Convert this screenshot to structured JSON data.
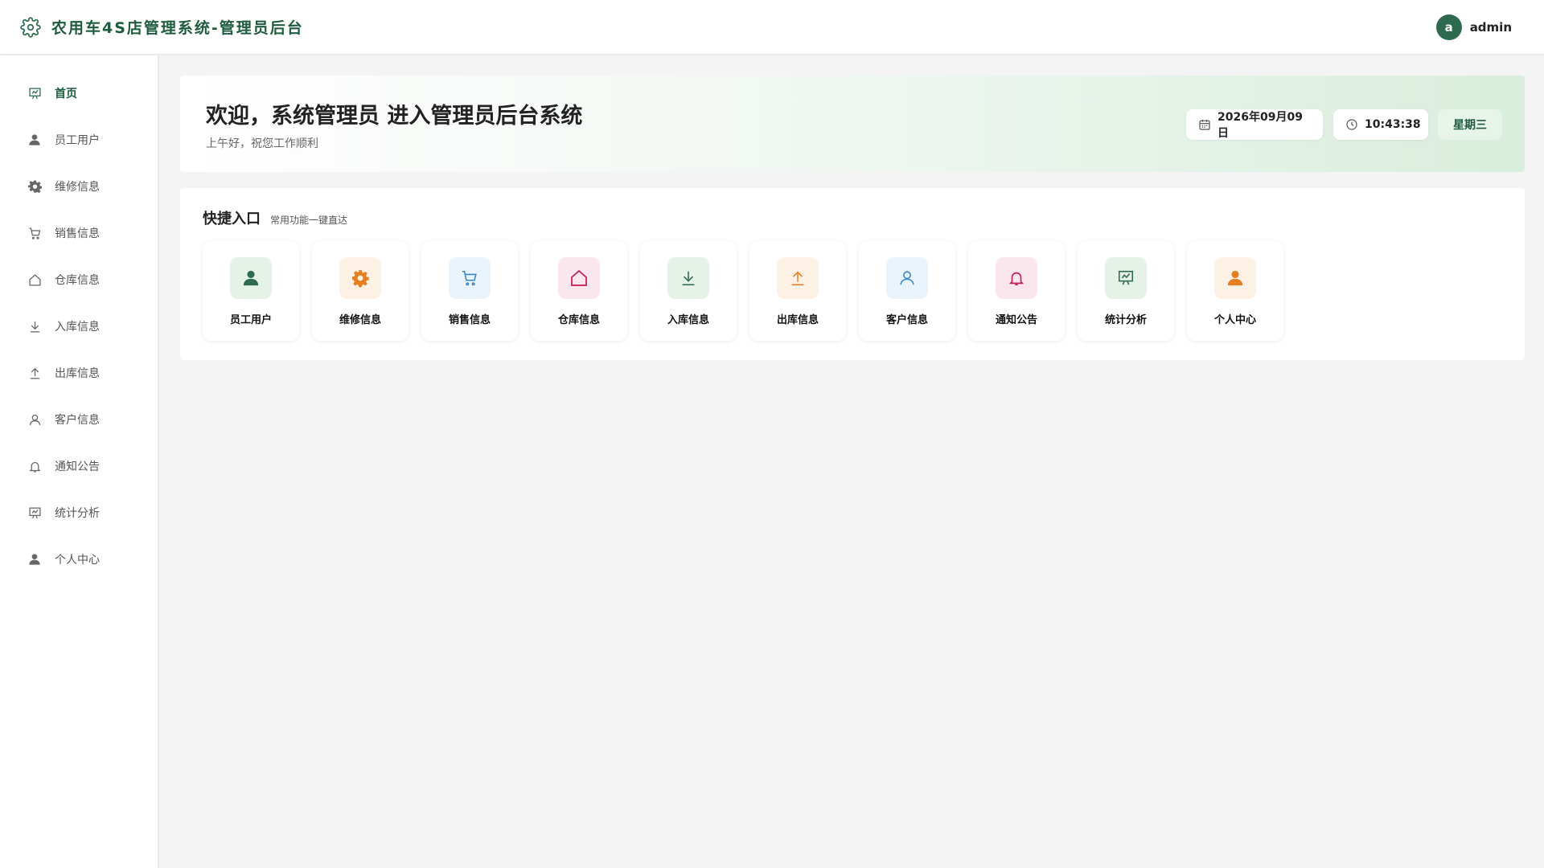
{
  "header": {
    "title": "农用车4S店管理系统-管理员后台",
    "avatar_letter": "a",
    "username": "admin"
  },
  "sidebar": {
    "items": [
      {
        "label": "首页",
        "icon": "chart-board-icon",
        "active": true
      },
      {
        "label": "员工用户",
        "icon": "user-icon",
        "active": false
      },
      {
        "label": "维修信息",
        "icon": "gear-icon",
        "active": false
      },
      {
        "label": "销售信息",
        "icon": "cart-icon",
        "active": false
      },
      {
        "label": "仓库信息",
        "icon": "home-icon",
        "active": false
      },
      {
        "label": "入库信息",
        "icon": "download-icon",
        "active": false
      },
      {
        "label": "出库信息",
        "icon": "upload-icon",
        "active": false
      },
      {
        "label": "客户信息",
        "icon": "user-outline-icon",
        "active": false
      },
      {
        "label": "通知公告",
        "icon": "bell-icon",
        "active": false
      },
      {
        "label": "统计分析",
        "icon": "chart-board-icon",
        "active": false
      },
      {
        "label": "个人中心",
        "icon": "user-icon",
        "active": false
      }
    ]
  },
  "welcome": {
    "title": "欢迎，系统管理员 进入管理员后台系统",
    "subtitle": "上午好，祝您工作顺利",
    "date": "2026年09月09日",
    "time": "10:43:38",
    "weekday": "星期三"
  },
  "quick": {
    "title": "快捷入口",
    "subtitle": "常用功能一键直达",
    "items": [
      {
        "label": "员工用户",
        "icon": "user-icon",
        "color": "#2d6a4f"
      },
      {
        "label": "维修信息",
        "icon": "gear-icon",
        "color": "#e67e22"
      },
      {
        "label": "销售信息",
        "icon": "cart-icon",
        "color": "#3b86c4"
      },
      {
        "label": "仓库信息",
        "icon": "home-icon",
        "color": "#c2185b"
      },
      {
        "label": "入库信息",
        "icon": "download-icon",
        "color": "#2d6a4f"
      },
      {
        "label": "出库信息",
        "icon": "upload-icon",
        "color": "#e67e22"
      },
      {
        "label": "客户信息",
        "icon": "user-outline-icon",
        "color": "#3b86c4"
      },
      {
        "label": "通知公告",
        "icon": "bell-icon",
        "color": "#c2185b"
      },
      {
        "label": "统计分析",
        "icon": "chart-board-icon",
        "color": "#2d6a4f"
      },
      {
        "label": "个人中心",
        "icon": "user-icon",
        "color": "#e67e22"
      }
    ]
  },
  "colors": {
    "primary": "#2d6a4f",
    "primary_text": "#1f5c3f",
    "background": "#f3f4f3"
  }
}
